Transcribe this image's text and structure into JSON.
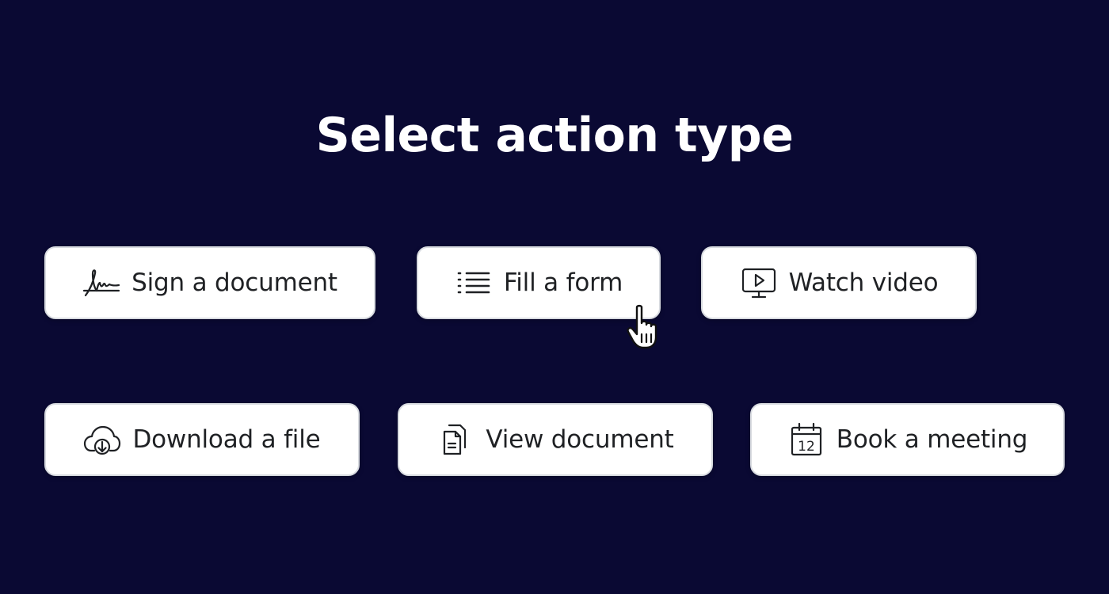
{
  "heading": "Select action type",
  "actions": [
    {
      "label": "Sign a document",
      "icon": "signature-icon"
    },
    {
      "label": "Fill a form",
      "icon": "list-icon"
    },
    {
      "label": "Watch video",
      "icon": "video-monitor-icon"
    },
    {
      "label": "Download a file",
      "icon": "cloud-download-icon"
    },
    {
      "label": "View document",
      "icon": "documents-icon"
    },
    {
      "label": "Book a meeting",
      "icon": "calendar-icon",
      "icon_text": "12"
    }
  ],
  "colors": {
    "background": "#0a0933",
    "button_bg": "#ffffff",
    "button_border": "#d8dbe0",
    "text": "#1f2124",
    "heading": "#ffffff"
  }
}
